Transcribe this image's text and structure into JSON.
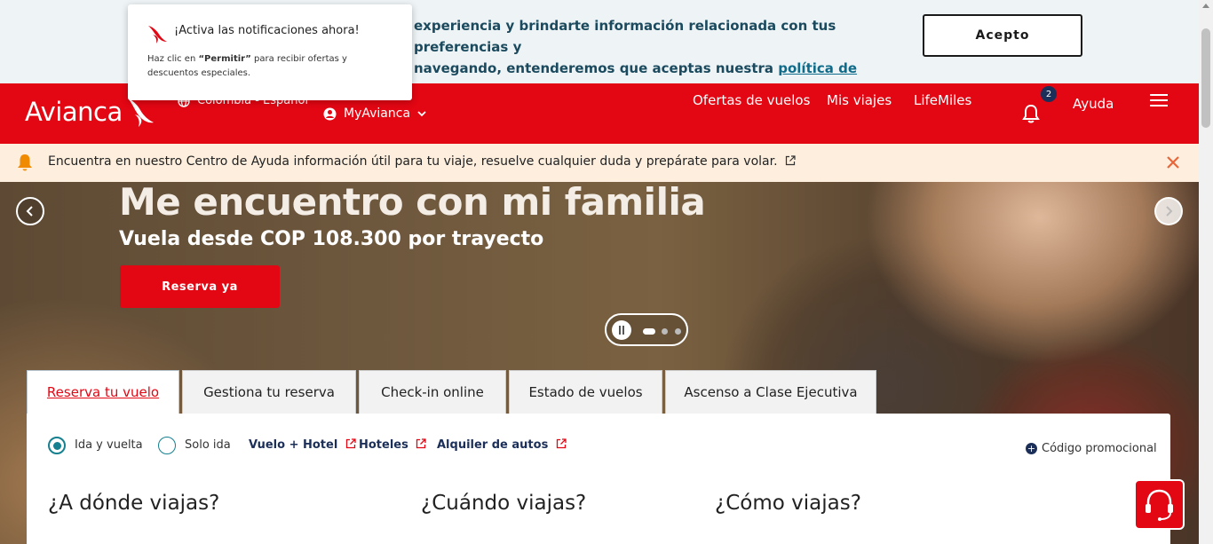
{
  "notification": {
    "title": "¡Activa las notificaciones ahora!",
    "body_prefix": "Haz clic en ",
    "body_bold": "“Permitir”",
    "body_suffix": " para recibir ofertas y descuentos especiales."
  },
  "cookies": {
    "text_line1": "experiencia y brindarte información relacionada con tus preferencias y",
    "text_line2": "navegando, entenderemos que aceptas nuestra ",
    "link": "política de cookies",
    "text_end": ".",
    "accept_label": "Acepto"
  },
  "header": {
    "logo": "Avianca",
    "language": "Colombia - Español",
    "myavianca": "MyAvianca",
    "nav": [
      "Ofertas de vuelos",
      "Mis viajes",
      "LifeMiles"
    ],
    "notifications_count": "2",
    "help": "Ayuda"
  },
  "infobar": {
    "text": "Encuentra en nuestro Centro de Ayuda información útil para tu viaje, resuelve cualquier duda y prepárate para volar."
  },
  "hero": {
    "title": "Me encuentro con mi familia",
    "subtitle": "Vuela desde COP 108.300 por trayecto",
    "cta": "Reserva ya"
  },
  "tabs": [
    "Reserva tu vuelo",
    "Gestiona tu reserva",
    "Check-in online",
    "Estado de vuelos",
    "Ascenso a Clase Ejecutiva"
  ],
  "booking": {
    "trip_types": [
      "Ida y vuelta",
      "Solo ida"
    ],
    "links": [
      "Vuelo + Hotel",
      "Hoteles",
      "Alquiler de autos"
    ],
    "promo": "Código promocional",
    "questions": [
      "¿A dónde viajas?",
      "¿Cuándo viajas?",
      "¿Cómo viajas?"
    ]
  },
  "colors": {
    "brand_red": "#e30613",
    "navy": "#1c2f59",
    "teal": "#15808f",
    "infobar_bg": "#fdeedd"
  }
}
